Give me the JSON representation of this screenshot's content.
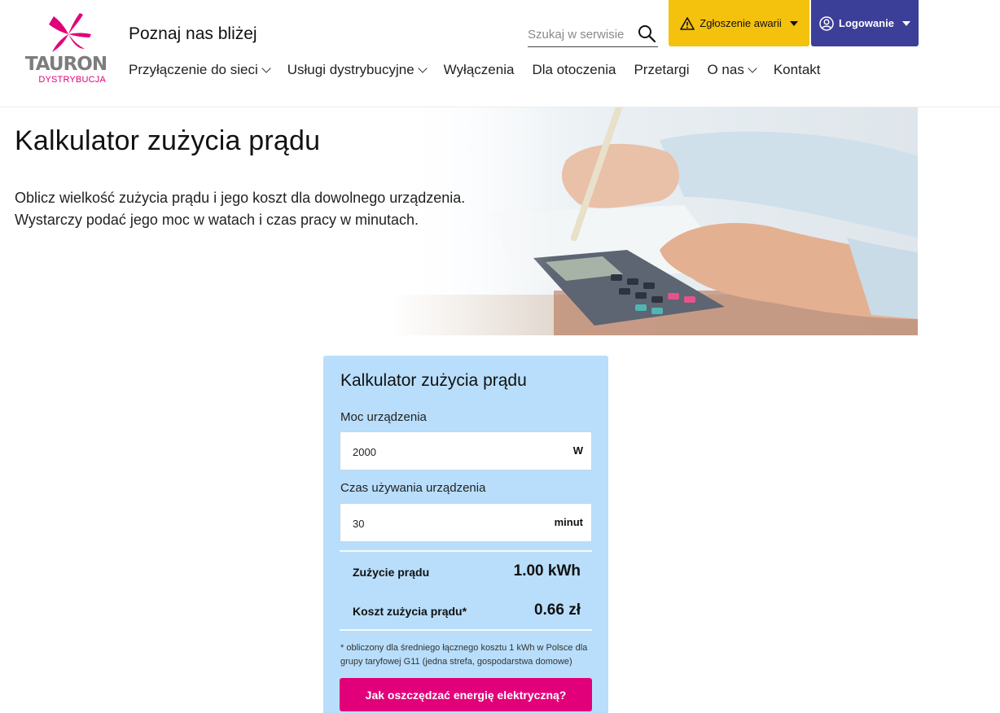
{
  "brand": {
    "name": "TAURON",
    "subname": "DYSTRYBUCJA",
    "magenta": "#e2007a",
    "gray": "#7d7d7d"
  },
  "header": {
    "tagline": "Poznaj nas bliżej",
    "search": {
      "placeholder": "Szukaj w serwisie",
      "icon": "search-icon"
    },
    "awaria": {
      "label": "Zgłoszenie awarii",
      "icon": "warning-icon",
      "color": "#f4c10d"
    },
    "login": {
      "label": "Logowanie",
      "icon": "user-circle-icon",
      "color": "#3c3f97"
    }
  },
  "nav": {
    "items": [
      {
        "label": "Przyłączenie do sieci",
        "has_dropdown": true
      },
      {
        "label": "Usługi dystrybucyjne",
        "has_dropdown": true
      },
      {
        "label": "Wyłączenia",
        "has_dropdown": false
      },
      {
        "label": "Dla otoczenia",
        "has_dropdown": false
      },
      {
        "label": "Przetargi",
        "has_dropdown": false
      },
      {
        "label": "O nas",
        "has_dropdown": true
      },
      {
        "label": "Kontakt",
        "has_dropdown": false
      }
    ]
  },
  "hero": {
    "title": "Kalkulator zużycia prądu",
    "description_line1": "Oblicz wielkość zużycia prądu i jego koszt dla dowolnego urządzenia.",
    "description_line2": "Wystarczy podać jego moc w watach i czas pracy w minutach."
  },
  "calculator": {
    "title": "Kalkulator zużycia prądu",
    "power": {
      "label": "Moc urządzenia",
      "value": "2000",
      "unit": "W"
    },
    "time": {
      "label": "Czas używania urządzenia",
      "value": "30",
      "unit": "minut"
    },
    "results": {
      "consumption_label": "Zużycie prądu",
      "consumption_value": "1.00 kWh",
      "cost_label": "Koszt zużycia prądu*",
      "cost_value": "0.66 zł"
    },
    "footnote": "* obliczony dla średniego łącznego kosztu 1 kWh w Polsce dla grupy taryfowej G11 (jedna strefa, gospodarstwa domowe)",
    "cta_label": "Jak oszczędzać energię elektryczną?",
    "card_color": "#b8defb"
  }
}
